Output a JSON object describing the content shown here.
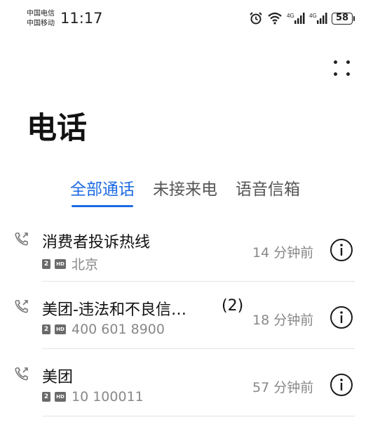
{
  "status_bar": {
    "carrier_1": "中国电信",
    "carrier_2": "中国移动",
    "time": "11:17",
    "network_1": "4G",
    "network_2": "4G",
    "battery": "58"
  },
  "header": {
    "title": "电话"
  },
  "tabs": [
    {
      "label": "全部通话",
      "active": true
    },
    {
      "label": "未接来电",
      "active": false
    },
    {
      "label": "语音信箱",
      "active": false
    }
  ],
  "calls": [
    {
      "name": "消费者投诉热线",
      "count": "",
      "sim": "2",
      "hd": "HD",
      "subtitle": "北京",
      "time": "14 分钟前"
    },
    {
      "name": "美团-违法和不良信…",
      "count": "(2)",
      "sim": "2",
      "hd": "HD",
      "subtitle": "400 601 8900",
      "time": "18 分钟前"
    },
    {
      "name": "美团",
      "count": "",
      "sim": "2",
      "hd": "HD",
      "subtitle": "10 100011",
      "time": "57 分钟前"
    }
  ],
  "colors": {
    "accent": "#1c6be3",
    "secondary_text": "#888888"
  }
}
